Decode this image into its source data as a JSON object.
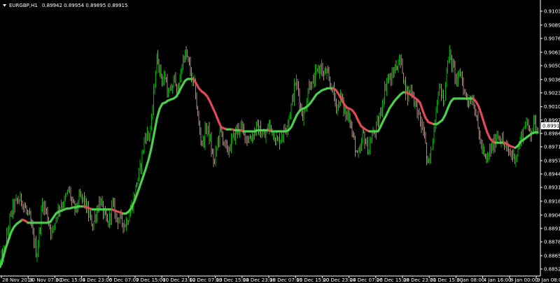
{
  "header": {
    "symbol": "EURGBP,H1",
    "ohlc": "0.89942 0.89954 0.89895 0.89915"
  },
  "current_price": "0.89915",
  "colors": {
    "background": "#000000",
    "up_bar": "#00b400",
    "down_bar": "#a98a80",
    "ma_up": "#4ccf4c",
    "ma_down": "#e04a56",
    "axis": "#ffffff"
  },
  "chart_data": {
    "type": "line",
    "title": "",
    "xlabel": "",
    "ylabel": "",
    "ylim": [
      0.8852,
      0.9103
    ],
    "grid": false,
    "y_ticks": [
      {
        "value": 0.9103,
        "label": "0.91030"
      },
      {
        "value": 0.90895,
        "label": "0.90895"
      },
      {
        "value": 0.90765,
        "label": "0.90765"
      },
      {
        "value": 0.9063,
        "label": "0.90630"
      },
      {
        "value": 0.905,
        "label": "0.90500"
      },
      {
        "value": 0.90365,
        "label": "0.90365"
      },
      {
        "value": 0.90235,
        "label": "0.90235"
      },
      {
        "value": 0.901,
        "label": "0.90100"
      },
      {
        "value": 0.8997,
        "label": "0.89970"
      },
      {
        "value": 0.8984,
        "label": "0.89840"
      },
      {
        "value": 0.8971,
        "label": "0.89710"
      },
      {
        "value": 0.89575,
        "label": "0.89575"
      },
      {
        "value": 0.89445,
        "label": "0.89445"
      },
      {
        "value": 0.89315,
        "label": "0.89315"
      },
      {
        "value": 0.8918,
        "label": "0.89180"
      },
      {
        "value": 0.89045,
        "label": "0.89045"
      },
      {
        "value": 0.88915,
        "label": "0.88915"
      },
      {
        "value": 0.88785,
        "label": "0.88785"
      },
      {
        "value": 0.8865,
        "label": "0.88650"
      },
      {
        "value": 0.8852,
        "label": "0.88520"
      }
    ],
    "x_ticks": [
      "28 Nov 2018",
      "30 Nov 07:00",
      "3 Dec 15:00",
      "4 Dec 23:00",
      "6 Dec 07:00",
      "7 Dec 15:00",
      "10 Dec 23:00",
      "12 Dec 07:00",
      "13 Dec 15:00",
      "14 Dec 23:00",
      "18 Dec 07:00",
      "19 Dec 15:00",
      "20 Dec 23:00",
      "24 Dec 07:00",
      "26 Dec 15:00",
      "28 Dec 23:00",
      "31 Dec 15:00",
      "3 Jan 08:00",
      "4 Jan 16:00",
      "8 Jan 00:00",
      "9 Jan 08:00"
    ],
    "ma_points": [
      [
        0,
        0.8854
      ],
      [
        4,
        0.8862
      ],
      [
        8,
        0.8872
      ],
      [
        12,
        0.888
      ],
      [
        16,
        0.8888
      ],
      [
        20,
        0.8893
      ],
      [
        24,
        0.8896
      ],
      [
        28,
        0.8898
      ],
      [
        32,
        0.89
      ],
      [
        36,
        0.8899
      ],
      [
        40,
        0.8897
      ],
      [
        44,
        0.8897
      ],
      [
        48,
        0.8897
      ],
      [
        52,
        0.8897
      ],
      [
        56,
        0.8897
      ],
      [
        60,
        0.8897
      ],
      [
        64,
        0.8897
      ],
      [
        68,
        0.8897
      ],
      [
        72,
        0.8898
      ],
      [
        76,
        0.8902
      ],
      [
        80,
        0.8906
      ],
      [
        84,
        0.8908
      ],
      [
        88,
        0.8909
      ],
      [
        92,
        0.891
      ],
      [
        96,
        0.8911
      ],
      [
        100,
        0.8911
      ],
      [
        104,
        0.8912
      ],
      [
        108,
        0.8912
      ],
      [
        112,
        0.8913
      ],
      [
        116,
        0.8913
      ],
      [
        120,
        0.8913
      ],
      [
        124,
        0.8912
      ],
      [
        128,
        0.8911
      ],
      [
        132,
        0.891
      ],
      [
        136,
        0.891
      ],
      [
        140,
        0.891
      ],
      [
        144,
        0.891
      ],
      [
        148,
        0.891
      ],
      [
        152,
        0.891
      ],
      [
        156,
        0.891
      ],
      [
        160,
        0.891
      ],
      [
        164,
        0.8909
      ],
      [
        168,
        0.8908
      ],
      [
        172,
        0.8907
      ],
      [
        176,
        0.8906
      ],
      [
        180,
        0.8906
      ],
      [
        184,
        0.8908
      ],
      [
        188,
        0.8912
      ],
      [
        192,
        0.8918
      ],
      [
        196,
        0.8925
      ],
      [
        200,
        0.8933
      ],
      [
        204,
        0.8941
      ],
      [
        208,
        0.8949
      ],
      [
        212,
        0.8958
      ],
      [
        216,
        0.8969
      ],
      [
        220,
        0.8983
      ],
      [
        224,
        0.8998
      ],
      [
        228,
        0.9008
      ],
      [
        232,
        0.9013
      ],
      [
        236,
        0.9014
      ],
      [
        240,
        0.9016
      ],
      [
        244,
        0.9017
      ],
      [
        248,
        0.9018
      ],
      [
        252,
        0.902
      ],
      [
        256,
        0.9025
      ],
      [
        260,
        0.903
      ],
      [
        264,
        0.9035
      ],
      [
        268,
        0.9037
      ],
      [
        272,
        0.9037
      ],
      [
        276,
        0.9037
      ],
      [
        280,
        0.9033
      ],
      [
        284,
        0.9028
      ],
      [
        288,
        0.9025
      ],
      [
        292,
        0.9023
      ],
      [
        296,
        0.902
      ],
      [
        300,
        0.9015
      ],
      [
        304,
        0.9009
      ],
      [
        308,
        0.9003
      ],
      [
        312,
        0.8996
      ],
      [
        316,
        0.899
      ],
      [
        320,
        0.8989
      ],
      [
        324,
        0.8988
      ],
      [
        328,
        0.8988
      ],
      [
        332,
        0.8988
      ],
      [
        336,
        0.8987
      ],
      [
        340,
        0.8987
      ],
      [
        344,
        0.8987
      ],
      [
        348,
        0.8986
      ],
      [
        352,
        0.8986
      ],
      [
        356,
        0.8986
      ],
      [
        360,
        0.8986
      ],
      [
        364,
        0.8986
      ],
      [
        368,
        0.8987
      ],
      [
        372,
        0.8987
      ],
      [
        376,
        0.8987
      ],
      [
        380,
        0.8987
      ],
      [
        384,
        0.8987
      ],
      [
        388,
        0.8986
      ],
      [
        392,
        0.8986
      ],
      [
        396,
        0.8986
      ],
      [
        400,
        0.8986
      ],
      [
        404,
        0.8986
      ],
      [
        408,
        0.8986
      ],
      [
        412,
        0.8987
      ],
      [
        416,
        0.899
      ],
      [
        420,
        0.8996
      ],
      [
        424,
        0.9002
      ],
      [
        428,
        0.9006
      ],
      [
        432,
        0.9008
      ],
      [
        436,
        0.9009
      ],
      [
        440,
        0.9011
      ],
      [
        444,
        0.9014
      ],
      [
        448,
        0.9018
      ],
      [
        452,
        0.9022
      ],
      [
        456,
        0.9024
      ],
      [
        460,
        0.9026
      ],
      [
        464,
        0.9027
      ],
      [
        468,
        0.9028
      ],
      [
        472,
        0.9028
      ],
      [
        476,
        0.9028
      ],
      [
        480,
        0.9026
      ],
      [
        484,
        0.9022
      ],
      [
        488,
        0.9017
      ],
      [
        492,
        0.9012
      ],
      [
        496,
        0.9009
      ],
      [
        500,
        0.9008
      ],
      [
        504,
        0.9006
      ],
      [
        508,
        0.9002
      ],
      [
        512,
        0.8996
      ],
      [
        516,
        0.8991
      ],
      [
        520,
        0.8989
      ],
      [
        524,
        0.8987
      ],
      [
        528,
        0.8986
      ],
      [
        532,
        0.8986
      ],
      [
        536,
        0.8986
      ],
      [
        540,
        0.8986
      ],
      [
        544,
        0.8991
      ],
      [
        548,
        0.8997
      ],
      [
        552,
        0.9002
      ],
      [
        556,
        0.9008
      ],
      [
        560,
        0.9012
      ],
      [
        564,
        0.9016
      ],
      [
        568,
        0.9019
      ],
      [
        572,
        0.9022
      ],
      [
        576,
        0.9024
      ],
      [
        580,
        0.9024
      ],
      [
        584,
        0.9023
      ],
      [
        588,
        0.9021
      ],
      [
        592,
        0.9019
      ],
      [
        596,
        0.9017
      ],
      [
        600,
        0.9014
      ],
      [
        604,
        0.9006
      ],
      [
        608,
        0.8999
      ],
      [
        612,
        0.8995
      ],
      [
        616,
        0.8994
      ],
      [
        620,
        0.8993
      ],
      [
        624,
        0.8993
      ],
      [
        628,
        0.8995
      ],
      [
        632,
        0.8997
      ],
      [
        636,
        0.9002
      ],
      [
        640,
        0.9009
      ],
      [
        644,
        0.9015
      ],
      [
        648,
        0.9018
      ],
      [
        652,
        0.9018
      ],
      [
        656,
        0.9018
      ],
      [
        660,
        0.9018
      ],
      [
        664,
        0.9018
      ],
      [
        668,
        0.9018
      ],
      [
        672,
        0.9018
      ],
      [
        676,
        0.9018
      ],
      [
        680,
        0.9015
      ],
      [
        684,
        0.901
      ],
      [
        688,
        0.9002
      ],
      [
        692,
        0.8993
      ],
      [
        696,
        0.8985
      ],
      [
        700,
        0.8979
      ],
      [
        704,
        0.8976
      ],
      [
        708,
        0.8975
      ],
      [
        712,
        0.8975
      ],
      [
        716,
        0.8975
      ],
      [
        720,
        0.8975
      ],
      [
        724,
        0.8974
      ],
      [
        728,
        0.8972
      ],
      [
        732,
        0.8971
      ],
      [
        736,
        0.897
      ],
      [
        740,
        0.8972
      ],
      [
        744,
        0.8976
      ],
      [
        748,
        0.8978
      ],
      [
        752,
        0.898
      ],
      [
        756,
        0.8982
      ],
      [
        760,
        0.8984
      ],
      [
        764,
        0.8985
      ],
      [
        768,
        0.8985
      ]
    ],
    "price_anchors": [
      [
        0,
        0.8858
      ],
      [
        6,
        0.887
      ],
      [
        12,
        0.8895
      ],
      [
        18,
        0.8912
      ],
      [
        24,
        0.8918
      ],
      [
        30,
        0.892
      ],
      [
        36,
        0.891
      ],
      [
        42,
        0.89
      ],
      [
        48,
        0.888
      ],
      [
        52,
        0.8865
      ],
      [
        56,
        0.889
      ],
      [
        60,
        0.8915
      ],
      [
        64,
        0.8912
      ],
      [
        70,
        0.8895
      ],
      [
        74,
        0.8886
      ],
      [
        80,
        0.8905
      ],
      [
        86,
        0.8915
      ],
      [
        92,
        0.8918
      ],
      [
        98,
        0.893
      ],
      [
        104,
        0.8912
      ],
      [
        108,
        0.891
      ],
      [
        114,
        0.8922
      ],
      [
        120,
        0.8918
      ],
      [
        126,
        0.8905
      ],
      [
        132,
        0.8895
      ],
      [
        136,
        0.8905
      ],
      [
        142,
        0.892
      ],
      [
        148,
        0.8905
      ],
      [
        154,
        0.8895
      ],
      [
        160,
        0.8915
      ],
      [
        166,
        0.8902
      ],
      [
        172,
        0.89
      ],
      [
        178,
        0.8895
      ],
      [
        184,
        0.8905
      ],
      [
        190,
        0.8918
      ],
      [
        196,
        0.894
      ],
      [
        200,
        0.895
      ],
      [
        204,
        0.897
      ],
      [
        208,
        0.8985
      ],
      [
        212,
        0.898
      ],
      [
        216,
        0.8995
      ],
      [
        220,
        0.903
      ],
      [
        224,
        0.906
      ],
      [
        228,
        0.9045
      ],
      [
        232,
        0.9035
      ],
      [
        236,
        0.904
      ],
      [
        240,
        0.902
      ],
      [
        246,
        0.903
      ],
      [
        250,
        0.904
      ],
      [
        254,
        0.902
      ],
      [
        258,
        0.9045
      ],
      [
        262,
        0.906
      ],
      [
        266,
        0.906
      ],
      [
        270,
        0.905
      ],
      [
        274,
        0.9035
      ],
      [
        278,
        0.903
      ],
      [
        282,
        0.9
      ],
      [
        286,
        0.898
      ],
      [
        290,
        0.8975
      ],
      [
        294,
        0.899
      ],
      [
        298,
        0.8985
      ],
      [
        302,
        0.8965
      ],
      [
        306,
        0.8955
      ],
      [
        310,
        0.8975
      ],
      [
        314,
        0.8985
      ],
      [
        318,
        0.898
      ],
      [
        324,
        0.8965
      ],
      [
        330,
        0.8975
      ],
      [
        336,
        0.8985
      ],
      [
        342,
        0.899
      ],
      [
        348,
        0.8985
      ],
      [
        354,
        0.8978
      ],
      [
        360,
        0.8982
      ],
      [
        366,
        0.899
      ],
      [
        372,
        0.8985
      ],
      [
        378,
        0.898
      ],
      [
        384,
        0.8992
      ],
      [
        390,
        0.8985
      ],
      [
        396,
        0.8975
      ],
      [
        402,
        0.8982
      ],
      [
        408,
        0.899
      ],
      [
        414,
        0.9005
      ],
      [
        418,
        0.902
      ],
      [
        422,
        0.9035
      ],
      [
        426,
        0.9025
      ],
      [
        430,
        0.9005
      ],
      [
        434,
        0.9
      ],
      [
        438,
        0.902
      ],
      [
        442,
        0.9035
      ],
      [
        446,
        0.903
      ],
      [
        450,
        0.904
      ],
      [
        454,
        0.9045
      ],
      [
        458,
        0.905
      ],
      [
        462,
        0.904
      ],
      [
        466,
        0.9045
      ],
      [
        470,
        0.903
      ],
      [
        474,
        0.903
      ],
      [
        478,
        0.9015
      ],
      [
        482,
        0.901
      ],
      [
        486,
        0.902
      ],
      [
        490,
        0.901
      ],
      [
        494,
        0.9
      ],
      [
        498,
        0.9005
      ],
      [
        502,
        0.8985
      ],
      [
        506,
        0.8975
      ],
      [
        510,
        0.896
      ],
      [
        514,
        0.8965
      ],
      [
        518,
        0.8985
      ],
      [
        522,
        0.8975
      ],
      [
        526,
        0.8968
      ],
      [
        530,
        0.898
      ],
      [
        534,
        0.8985
      ],
      [
        538,
        0.899
      ],
      [
        542,
        0.9
      ],
      [
        546,
        0.9015
      ],
      [
        550,
        0.903
      ],
      [
        554,
        0.904
      ],
      [
        558,
        0.9035
      ],
      [
        562,
        0.9045
      ],
      [
        566,
        0.905
      ],
      [
        570,
        0.9055
      ],
      [
        574,
        0.905
      ],
      [
        578,
        0.903
      ],
      [
        582,
        0.902
      ],
      [
        586,
        0.903
      ],
      [
        590,
        0.902
      ],
      [
        594,
        0.901
      ],
      [
        598,
        0.9
      ],
      [
        602,
        0.899
      ],
      [
        606,
        0.8985
      ],
      [
        610,
        0.895
      ],
      [
        614,
        0.896
      ],
      [
        618,
        0.898
      ],
      [
        622,
        0.9005
      ],
      [
        626,
        0.903
      ],
      [
        630,
        0.9025
      ],
      [
        634,
        0.901
      ],
      [
        638,
        0.9055
      ],
      [
        642,
        0.906
      ],
      [
        646,
        0.905
      ],
      [
        650,
        0.904
      ],
      [
        654,
        0.9035
      ],
      [
        658,
        0.9045
      ],
      [
        662,
        0.9025
      ],
      [
        666,
        0.902
      ],
      [
        670,
        0.9015
      ],
      [
        674,
        0.902
      ],
      [
        678,
        0.901
      ],
      [
        682,
        0.899
      ],
      [
        686,
        0.8975
      ],
      [
        690,
        0.8965
      ],
      [
        694,
        0.8955
      ],
      [
        698,
        0.8965
      ],
      [
        702,
        0.897
      ],
      [
        706,
        0.8975
      ],
      [
        710,
        0.8985
      ],
      [
        714,
        0.898
      ],
      [
        718,
        0.8975
      ],
      [
        722,
        0.897
      ],
      [
        726,
        0.8965
      ],
      [
        730,
        0.8965
      ],
      [
        734,
        0.896
      ],
      [
        738,
        0.8965
      ],
      [
        742,
        0.8975
      ],
      [
        746,
        0.8985
      ],
      [
        750,
        0.8995
      ],
      [
        754,
        0.899
      ],
      [
        758,
        0.8985
      ],
      [
        762,
        0.8995
      ],
      [
        766,
        0.899
      ],
      [
        768,
        0.8992
      ]
    ]
  }
}
